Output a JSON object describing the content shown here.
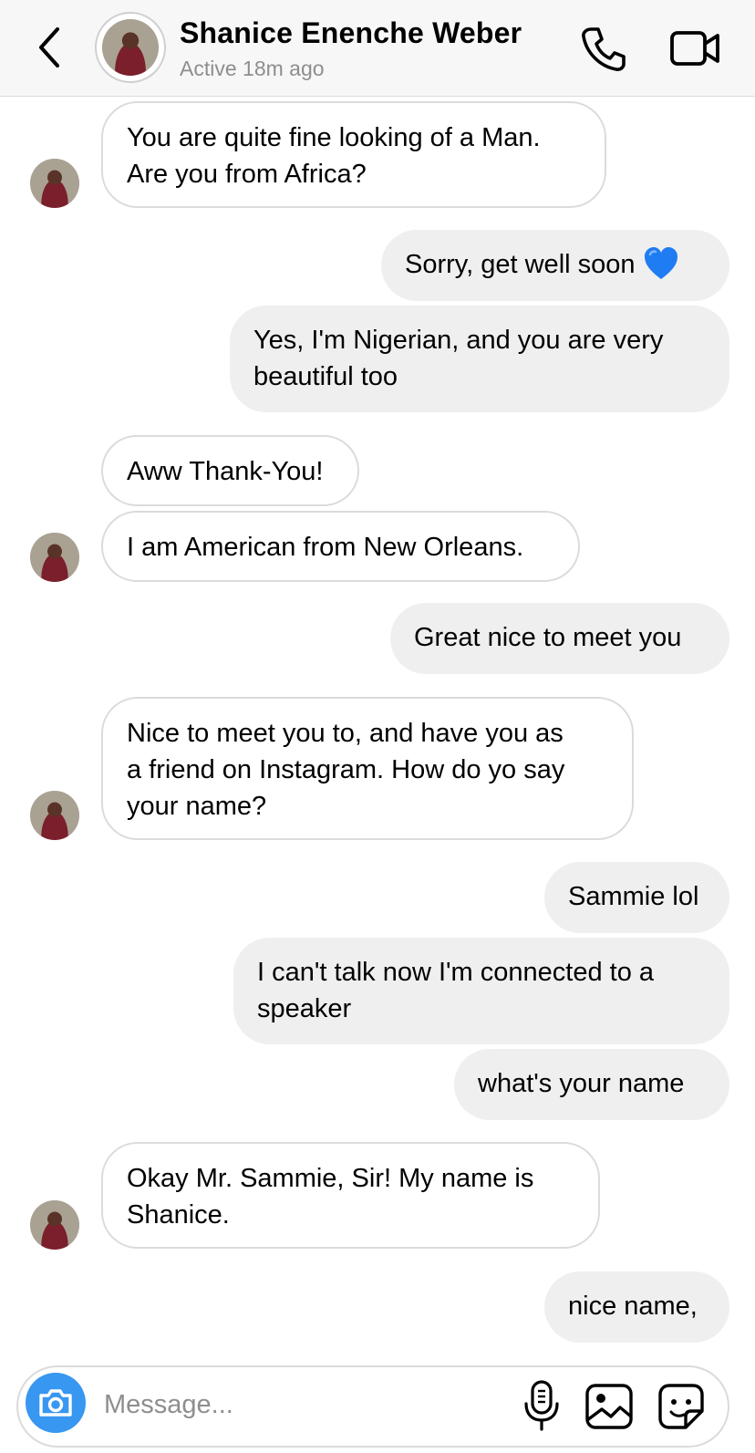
{
  "header": {
    "contact_name": "Shanice Enenche Weber",
    "status": "Active 18m ago",
    "icons": {
      "back": "chevron-left-icon",
      "call": "phone-icon",
      "video": "video-camera-icon"
    }
  },
  "messages": [
    {
      "direction": "incoming",
      "lines": [
        "You are quite fine looking of a Man.",
        "Are you from Africa?"
      ]
    },
    {
      "direction": "outgoing",
      "lines": [
        "Sorry, get well soon"
      ],
      "emoji": "blue-heart"
    },
    {
      "direction": "outgoing",
      "lines": [
        "Yes, I'm Nigerian, and you are very",
        "beautiful too"
      ]
    },
    {
      "direction": "incoming",
      "lines": [
        "Aww Thank-You!"
      ]
    },
    {
      "direction": "incoming",
      "lines": [
        "I am American from New Orleans."
      ]
    },
    {
      "direction": "outgoing",
      "lines": [
        "Great nice to meet you"
      ]
    },
    {
      "direction": "incoming",
      "lines": [
        "Nice to meet you to, and have you as",
        "a friend on Instagram. How do yo say",
        "your name?"
      ]
    },
    {
      "direction": "outgoing",
      "lines": [
        "Sammie lol"
      ]
    },
    {
      "direction": "outgoing",
      "lines": [
        "I can't talk now I'm connected to a",
        "speaker"
      ]
    },
    {
      "direction": "outgoing",
      "lines": [
        "what's your name"
      ]
    },
    {
      "direction": "incoming",
      "lines": [
        "Okay Mr. Sammie, Sir!  My name is",
        "Shanice."
      ]
    },
    {
      "direction": "outgoing",
      "lines": [
        "nice name,"
      ]
    }
  ],
  "composer": {
    "placeholder": "Message...",
    "value": "",
    "icons": {
      "camera": "camera-icon",
      "mic": "microphone-icon",
      "gallery": "image-icon",
      "sticker": "sticker-icon"
    },
    "accent_color": "#3897f0"
  },
  "colors": {
    "outgoing_bubble": "#efefef",
    "incoming_border": "#dbdbdb",
    "status_text": "#8e8e8e"
  }
}
